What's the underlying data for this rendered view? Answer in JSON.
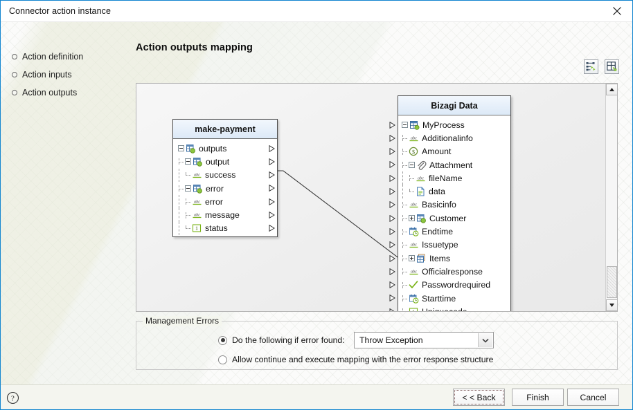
{
  "window": {
    "title": "Connector action instance",
    "close_icon": "close-icon"
  },
  "sidebar": {
    "items": [
      {
        "label": "Action definition",
        "bullet": "circle-bullet-icon"
      },
      {
        "label": "Action inputs",
        "bullet": "circle-bullet-icon"
      },
      {
        "label": "Action outputs",
        "bullet": "circle-bullet-icon"
      }
    ]
  },
  "main": {
    "page_title": "Action outputs mapping",
    "toolbar": [
      {
        "name": "auto-map-icon",
        "title": "Auto map"
      },
      {
        "name": "arrange-layout-icon",
        "title": "Arrange"
      }
    ]
  },
  "source_tree": {
    "header": "make-payment",
    "rows": [
      {
        "label": "outputs",
        "indent": 0,
        "expander": "minus",
        "icon": "table-green-icon",
        "last": false
      },
      {
        "label": "output",
        "indent": 1,
        "expander": "minus",
        "icon": "table-green-icon",
        "last": false
      },
      {
        "label": "success",
        "indent": 2,
        "expander": "none",
        "icon": "abc-string-icon",
        "last": true
      },
      {
        "label": "error",
        "indent": 1,
        "expander": "minus",
        "icon": "table-green-icon",
        "last": false
      },
      {
        "label": "error",
        "indent": 2,
        "expander": "none",
        "icon": "abc-string-icon",
        "last": false
      },
      {
        "label": "message",
        "indent": 2,
        "expander": "none",
        "icon": "abc-string-icon",
        "last": false
      },
      {
        "label": "status",
        "indent": 2,
        "expander": "none",
        "icon": "number-one-icon",
        "last": true
      }
    ]
  },
  "target_tree": {
    "header": "Bizagi Data",
    "rows": [
      {
        "label": "MyProcess",
        "indent": 0,
        "expander": "minus",
        "icon": "entity-green-icon",
        "last": false
      },
      {
        "label": "Additionalinfo",
        "indent": 1,
        "expander": "none",
        "icon": "abc-string-icon",
        "last": false
      },
      {
        "label": "Amount",
        "indent": 1,
        "expander": "none",
        "icon": "currency-icon",
        "last": false
      },
      {
        "label": "Attachment",
        "indent": 1,
        "expander": "minus",
        "icon": "paperclip-icon",
        "last": false
      },
      {
        "label": "fileName",
        "indent": 2,
        "expander": "none",
        "icon": "abc-string-icon",
        "last": false
      },
      {
        "label": "data",
        "indent": 2,
        "expander": "none",
        "icon": "file-icon",
        "last": true
      },
      {
        "label": "Basicinfo",
        "indent": 1,
        "expander": "none",
        "icon": "abc-string-icon",
        "last": false
      },
      {
        "label": "Customer",
        "indent": 1,
        "expander": "plus",
        "icon": "table-green-icon",
        "last": false
      },
      {
        "label": "Endtime",
        "indent": 1,
        "expander": "none",
        "icon": "calendar-clock-icon",
        "last": false
      },
      {
        "label": "Issuetype",
        "indent": 1,
        "expander": "none",
        "icon": "abc-string-icon",
        "last": false
      },
      {
        "label": "Items",
        "indent": 1,
        "expander": "plus",
        "icon": "collection-icon",
        "last": false
      },
      {
        "label": "Officialresponse",
        "indent": 1,
        "expander": "none",
        "icon": "abc-string-icon",
        "last": false
      },
      {
        "label": "Passwordrequired",
        "indent": 1,
        "expander": "none",
        "icon": "check-boolean-icon",
        "last": false
      },
      {
        "label": "Starttime",
        "indent": 1,
        "expander": "none",
        "icon": "calendar-clock-icon",
        "last": false
      },
      {
        "label": "Uniquecode",
        "indent": 1,
        "expander": "none",
        "icon": "number-one-icon",
        "last": false
      }
    ]
  },
  "mapping_links": [
    {
      "from": "success",
      "to": "Officialresponse"
    }
  ],
  "scrollbar": {
    "up_arrow": "scroll-up-icon",
    "down_arrow": "scroll-down-icon",
    "thumb_position": "bottom"
  },
  "management_errors": {
    "legend": "Management Errors",
    "option_1_label": "Do the following if error found:",
    "option_1_selected": true,
    "option_2_label": "Allow continue and execute mapping with the error response structure",
    "option_2_selected": false,
    "select_value": "Throw Exception",
    "select_options": [
      "Throw Exception"
    ],
    "dropdown_icon": "chevron-down-icon"
  },
  "footer": {
    "help_icon": "help-question-icon",
    "back_label": "< < Back",
    "finish_label": "Finish",
    "cancel_label": "Cancel"
  },
  "colors": {
    "accent_border": "#0f84cf",
    "tree_header": "#dce9f7",
    "icon_green": "#7ab317",
    "watermark": "#e5e8d4"
  }
}
